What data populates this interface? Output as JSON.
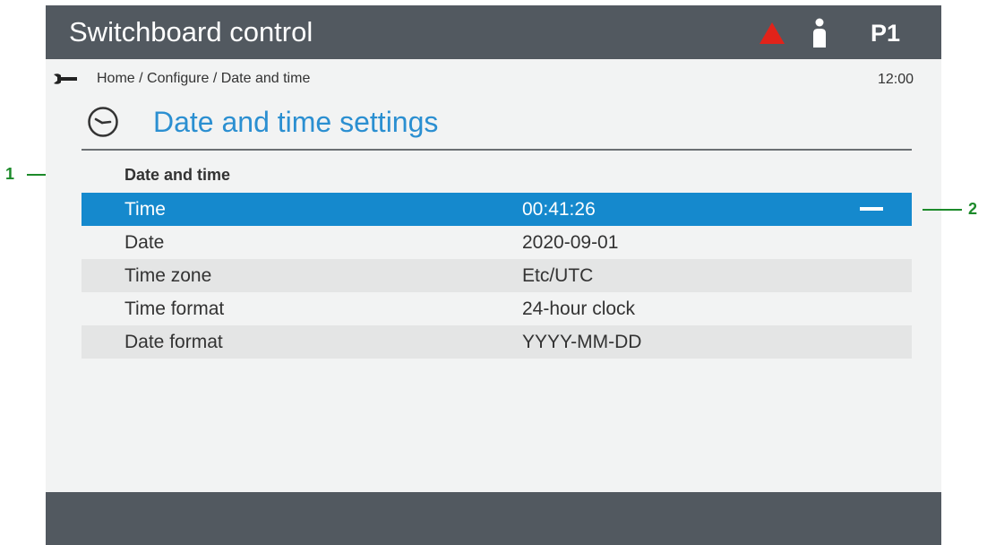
{
  "header": {
    "title": "Switchboard control",
    "profile": "P1",
    "icons": [
      "alarm-triangle-icon",
      "user-icon"
    ],
    "alarm_color": "#e2231a"
  },
  "nav": {
    "breadcrumb": "Home / Configure / Date and time",
    "clock": "12:00",
    "icon": "wrench-icon"
  },
  "page": {
    "title": "Date and time settings",
    "title_icon": "clock-icon",
    "accent_color": "#2b8fd1"
  },
  "section": {
    "heading": "Date and time"
  },
  "settings": [
    {
      "label": "Time",
      "value": "00:41:26",
      "selected": true
    },
    {
      "label": "Date",
      "value": "2020-09-01",
      "selected": false
    },
    {
      "label": "Time zone",
      "value": "Etc/UTC",
      "selected": false
    },
    {
      "label": "Time format",
      "value": "24-hour clock",
      "selected": false
    },
    {
      "label": "Date format",
      "value": "YYYY-MM-DD",
      "selected": false
    }
  ],
  "selection_color": "#1589cd",
  "callouts": {
    "section": "1",
    "selected_row": "2",
    "color": "#1c8a2a"
  }
}
